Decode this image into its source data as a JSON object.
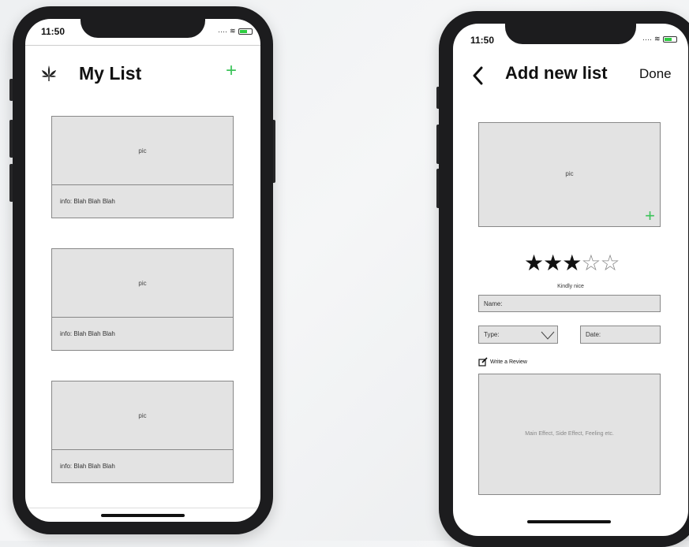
{
  "left_phone": {
    "time": "11:50",
    "title": "My List",
    "add_icon_glyph": "+",
    "logo_icon": "leaf-icon",
    "cards": [
      {
        "pic": "pic",
        "info": "info: Blah Blah Blah"
      },
      {
        "pic": "pic",
        "info": "info: Blah Blah Blah"
      },
      {
        "pic": "pic",
        "info": "info: Blah Blah Blah"
      }
    ]
  },
  "right_phone": {
    "time": "11:50",
    "back_glyph": "‹",
    "title": "Add new list",
    "done_label": "Done",
    "pic": "pic",
    "add_photo_glyph": "+",
    "rating": {
      "stars_filled": 3,
      "stars_total": 5,
      "caption": "Kindly nice"
    },
    "name_label": "Name:",
    "type_label": "Type:",
    "date_label": "Date:",
    "review_label": "Write a Review",
    "review_placeholder": "Main Effect, Side Effect, Feeling etc."
  },
  "colors": {
    "accent_green": "#3cc35a",
    "frame": "#1c1c1e",
    "placeholder_gray": "#e3e3e3"
  }
}
